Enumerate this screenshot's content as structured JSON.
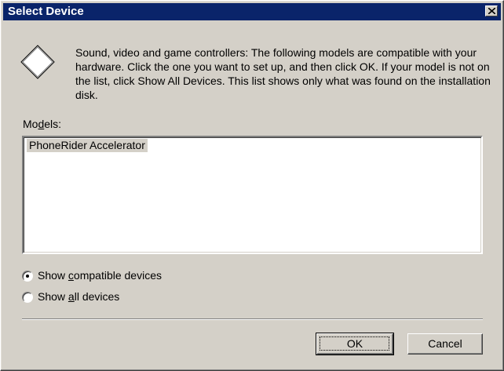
{
  "window": {
    "title": "Select Device",
    "close_glyph": "×"
  },
  "description": "Sound, video and game controllers: The following models are compatible with your hardware. Click the one you want to set up, and then click OK. If your model is not on the list, click Show All Devices. This list shows only what was found on the installation disk.",
  "models": {
    "label_prefix": "Mo",
    "label_accel": "d",
    "label_suffix": "els:",
    "items": [
      "PhoneRider Accelerator"
    ],
    "selected_index": 0
  },
  "options": {
    "compatible": {
      "prefix": "Show ",
      "accel": "c",
      "suffix": "ompatible devices",
      "checked": true
    },
    "all": {
      "prefix": "Show ",
      "accel": "a",
      "suffix": "ll devices",
      "checked": false
    }
  },
  "buttons": {
    "ok": "OK",
    "cancel": "Cancel"
  },
  "icons": {
    "device": "diamond-device-icon",
    "close": "close-icon"
  },
  "colors": {
    "titlebar": "#0a246a",
    "face": "#d4d0c8",
    "selection": "#d4d0c8"
  }
}
